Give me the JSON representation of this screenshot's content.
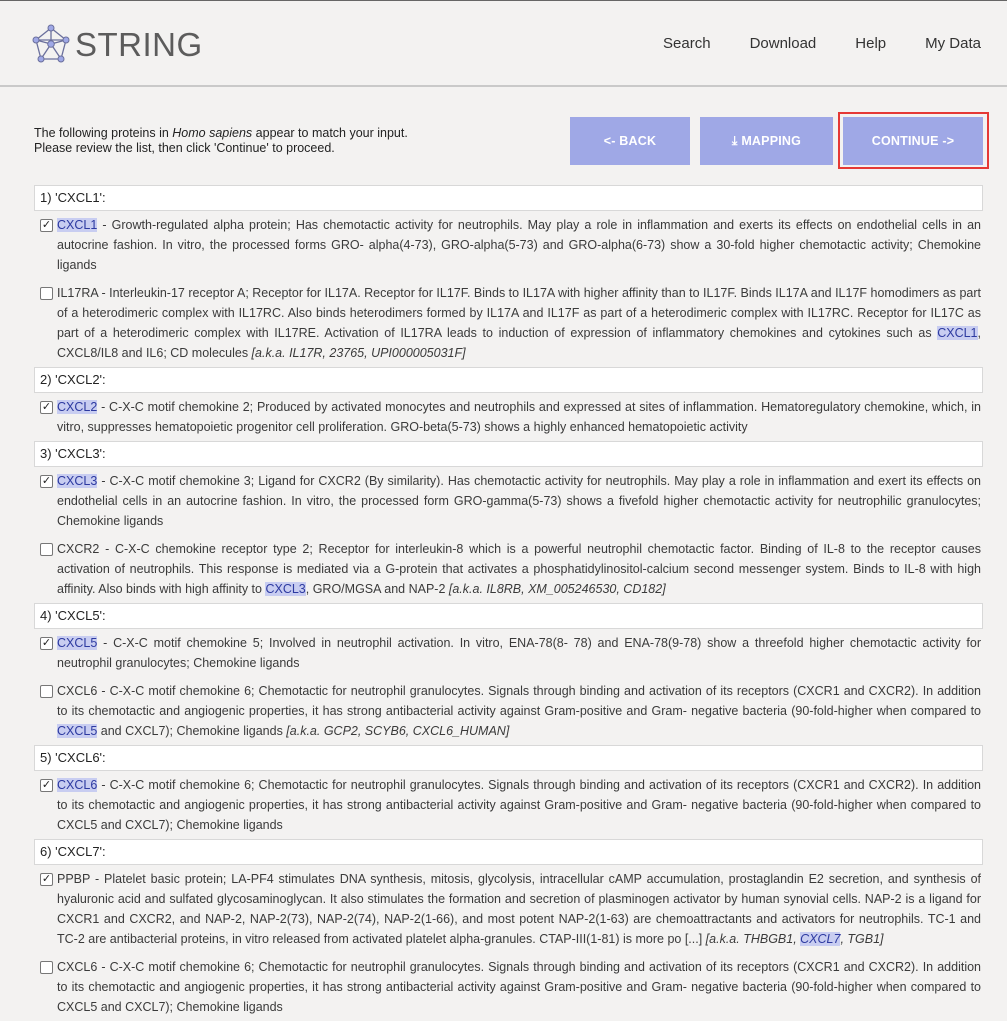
{
  "header": {
    "logo_text": "STRING",
    "nav": [
      "Search",
      "Download",
      "Help",
      "My Data"
    ]
  },
  "intro": {
    "line1_pre": "The following proteins in ",
    "species": "Homo sapiens",
    "line1_post": " appear to match your input.",
    "line2": "Please review the list, then click 'Continue' to proceed."
  },
  "buttons": {
    "back": "<- BACK",
    "mapping": "⤓ MAPPING",
    "continue": "CONTINUE ->"
  },
  "queries": [
    {
      "label": "1) 'CXCL1':",
      "items": [
        {
          "checked": true,
          "name": "CXCL1",
          "hl_name": true,
          "desc": " - Growth-regulated alpha protein; Has chemotactic activity for neutrophils. May play a role in inflammation and exerts its effects on endothelial cells in an autocrine fashion. In vitro, the processed forms GRO- alpha(4-73), GRO-alpha(5-73) and GRO-alpha(6-73) show a 30-fold higher chemotactic activity; Chemokine ligands",
          "hl": "",
          "desc2": "",
          "aka": ""
        },
        {
          "checked": false,
          "name": "IL17RA",
          "hl_name": false,
          "desc": " - Interleukin-17 receptor A; Receptor for IL17A. Receptor for IL17F. Binds to IL17A with higher affinity than to IL17F. Binds IL17A and IL17F homodimers as part of a heterodimeric complex with IL17RC. Also binds heterodimers formed by IL17A and IL17F as part of a heterodimeric complex with IL17RC. Receptor for IL17C as part of a heterodimeric complex with IL17RE. Activation of IL17RA leads to induction of expression of inflammatory chemokines and cytokines such as ",
          "hl": "CXCL1",
          "desc2": ", CXCL8/IL8 and IL6; CD molecules ",
          "aka": "[a.k.a. IL17R, 23765, UPI000005031F]"
        }
      ]
    },
    {
      "label": "2) 'CXCL2':",
      "items": [
        {
          "checked": true,
          "name": "CXCL2",
          "hl_name": true,
          "desc": " - C-X-C motif chemokine 2; Produced by activated monocytes and neutrophils and expressed at sites of inflammation. Hematoregulatory chemokine, which, in vitro, suppresses hematopoietic progenitor cell proliferation. GRO-beta(5-73) shows a highly enhanced hematopoietic activity",
          "hl": "",
          "desc2": "",
          "aka": ""
        }
      ]
    },
    {
      "label": "3) 'CXCL3':",
      "items": [
        {
          "checked": true,
          "name": "CXCL3",
          "hl_name": true,
          "desc": " - C-X-C motif chemokine 3; Ligand for CXCR2 (By similarity). Has chemotactic activity for neutrophils. May play a role in inflammation and exert its effects on endothelial cells in an autocrine fashion. In vitro, the processed form GRO-gamma(5-73) shows a fivefold higher chemotactic activity for neutrophilic granulocytes; Chemokine ligands",
          "hl": "",
          "desc2": "",
          "aka": ""
        },
        {
          "checked": false,
          "name": "CXCR2",
          "hl_name": false,
          "desc": " - C-X-C chemokine receptor type 2; Receptor for interleukin-8 which is a powerful neutrophil chemotactic factor. Binding of IL-8 to the receptor causes activation of neutrophils. This response is mediated via a G-protein that activates a phosphatidylinositol-calcium second messenger system. Binds to IL-8 with high affinity. Also binds with high affinity to ",
          "hl": "CXCL3",
          "desc2": ", GRO/MGSA and NAP-2 ",
          "aka": "[a.k.a. IL8RB, XM_005246530, CD182]"
        }
      ]
    },
    {
      "label": "4) 'CXCL5':",
      "items": [
        {
          "checked": true,
          "name": "CXCL5",
          "hl_name": true,
          "desc": " - C-X-C motif chemokine 5; Involved in neutrophil activation. In vitro, ENA-78(8- 78) and ENA-78(9-78) show a threefold higher chemotactic activity for neutrophil granulocytes; Chemokine ligands",
          "hl": "",
          "desc2": "",
          "aka": ""
        },
        {
          "checked": false,
          "name": "CXCL6",
          "hl_name": false,
          "desc": " - C-X-C motif chemokine 6; Chemotactic for neutrophil granulocytes. Signals through binding and activation of its receptors (CXCR1 and CXCR2). In addition to its chemotactic and angiogenic properties, it has strong antibacterial activity against Gram-positive and Gram- negative bacteria (90-fold-higher when compared to ",
          "hl": "CXCL5",
          "desc2": " and CXCL7); Chemokine ligands ",
          "aka": "[a.k.a. GCP2, SCYB6, CXCL6_HUMAN]"
        }
      ]
    },
    {
      "label": "5) 'CXCL6':",
      "items": [
        {
          "checked": true,
          "name": "CXCL6",
          "hl_name": true,
          "desc": " - C-X-C motif chemokine 6; Chemotactic for neutrophil granulocytes. Signals through binding and activation of its receptors (CXCR1 and CXCR2). In addition to its chemotactic and angiogenic properties, it has strong antibacterial activity against Gram-positive and Gram- negative bacteria (90-fold-higher when compared to CXCL5 and CXCL7); Chemokine ligands",
          "hl": "",
          "desc2": "",
          "aka": ""
        }
      ]
    },
    {
      "label": "6) 'CXCL7':",
      "items": [
        {
          "checked": true,
          "name": "PPBP",
          "hl_name": false,
          "desc": " - Platelet basic protein; LA-PF4 stimulates DNA synthesis, mitosis, glycolysis, intracellular cAMP accumulation, prostaglandin E2 secretion, and synthesis of hyaluronic acid and sulfated glycosaminoglycan. It also stimulates the formation and secretion of plasminogen activator by human synovial cells. NAP-2 is a ligand for CXCR1 and CXCR2, and NAP-2, NAP-2(73), NAP-2(74), NAP-2(1-66), and most potent NAP-2(1-63) are chemoattractants and activators for neutrophils. TC-1 and TC-2 are antibacterial proteins, in vitro released from activated platelet alpha-granules. CTAP-III(1-81) is more po [...] ",
          "hl": "",
          "desc2": "",
          "aka": "[a.k.a. THBGB1, ",
          "aka_hl": "CXCL7",
          "aka2": ", TGB1]"
        },
        {
          "checked": false,
          "name": "CXCL6",
          "hl_name": false,
          "desc": " - C-X-C motif chemokine 6; Chemotactic for neutrophil granulocytes. Signals through binding and activation of its receptors (CXCR1 and CXCR2). In addition to its chemotactic and angiogenic properties, it has strong antibacterial activity against Gram-positive and Gram- negative bacteria (90-fold-higher when compared to CXCL5 and CXCL7); Chemokine ligands",
          "hl": "",
          "desc2": "",
          "aka": ""
        }
      ]
    }
  ],
  "colors": {
    "button": "#9fa8e6",
    "highlight": "#c8cdf1",
    "focus_outline": "#e53935"
  }
}
